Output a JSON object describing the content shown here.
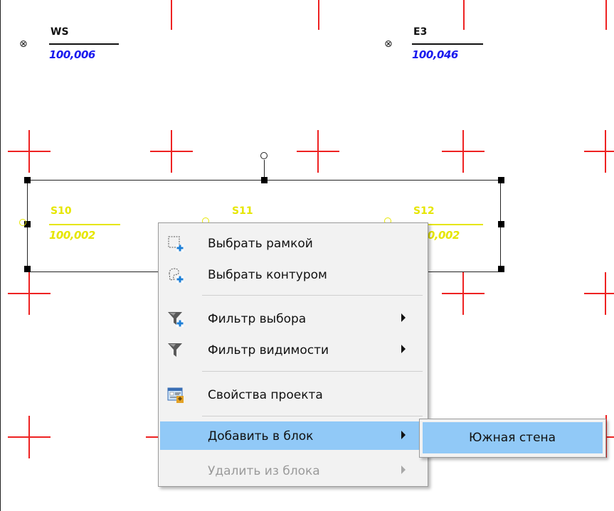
{
  "points": {
    "ws": {
      "name": "WS",
      "value": "100,006"
    },
    "e3": {
      "name": "E3",
      "value": "100,046"
    },
    "s10": {
      "name": "S10",
      "value": "100,002"
    },
    "s11": {
      "name": "S11",
      "value": ""
    },
    "s12": {
      "name": "S12",
      "value": "100,002"
    }
  },
  "marker_glyph": "⊗",
  "colors": {
    "grid": "#ee2222",
    "point_blue": "#1a1aee",
    "point_yellow": "#e6e600",
    "highlight": "#91c9f7"
  },
  "context_menu": {
    "select_frame": "Выбрать рамкой",
    "select_contour": "Выбрать контуром",
    "selection_filter": "Фильтр выбора",
    "visibility_filter": "Фильтр видимости",
    "project_properties": "Свойства проекта",
    "add_to_block": "Добавить в блок",
    "remove_from_block": "Удалить из блока"
  },
  "submenu": {
    "south_wall": "Южная стена"
  }
}
